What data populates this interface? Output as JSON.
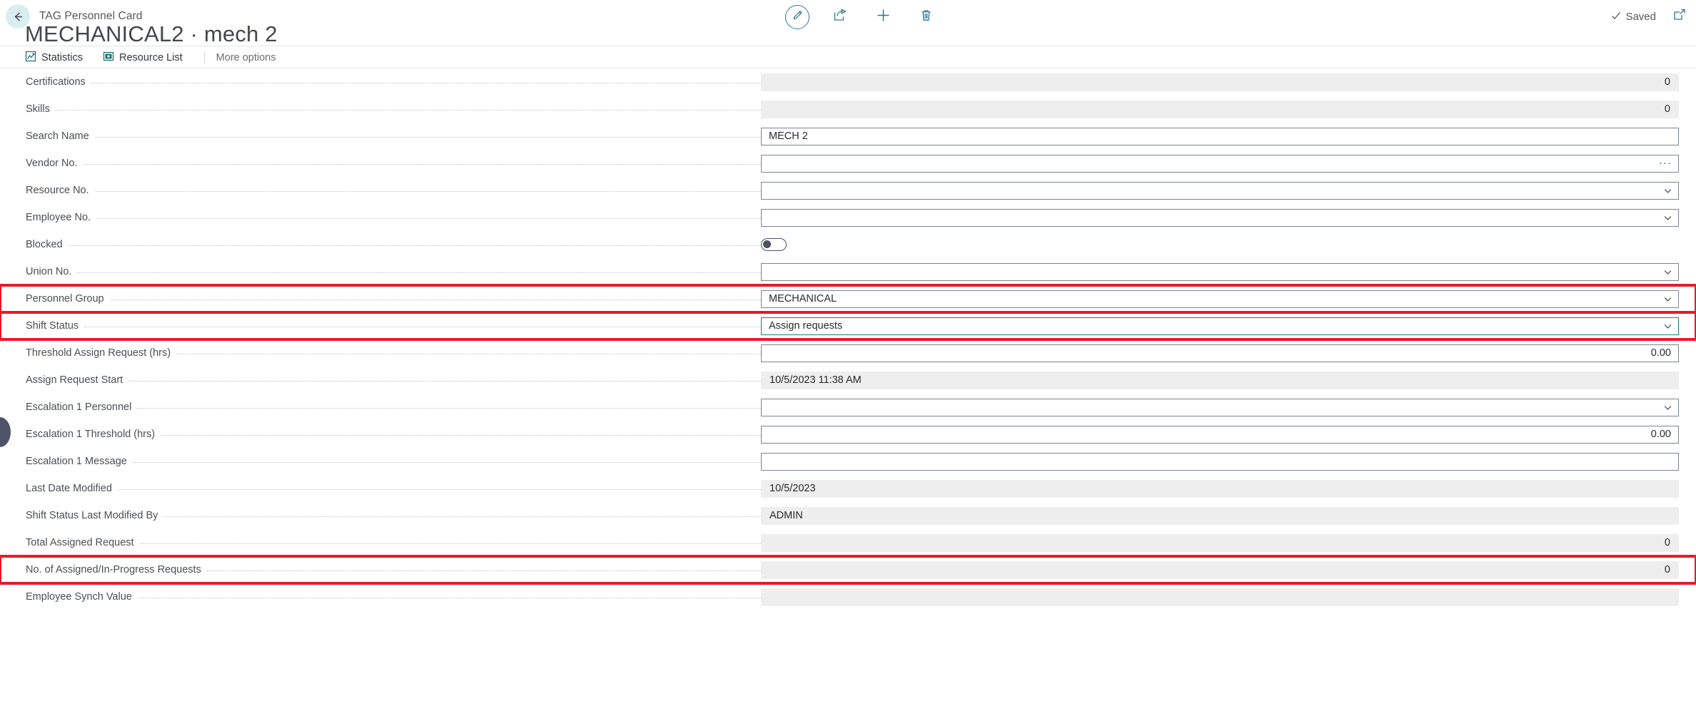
{
  "header": {
    "back_label": "back-arrow",
    "page_type": "TAG Personnel Card",
    "title": "MECHANICAL2 · mech 2",
    "saved_status": "Saved",
    "tools": [
      {
        "name": "edit-pencil-icon",
        "label": "Edit"
      },
      {
        "name": "share-icon",
        "label": "Share"
      },
      {
        "name": "new-plus-icon",
        "label": "New"
      },
      {
        "name": "delete-trash-icon",
        "label": "Delete"
      }
    ],
    "expand_label": "Open in new window"
  },
  "ribbon": {
    "items": [
      {
        "label": "Statistics",
        "icon": "statistics-chart-icon"
      },
      {
        "label": "Resource List",
        "icon": "resource-list-icon"
      }
    ],
    "more_options": "More options"
  },
  "fields": [
    {
      "label": "Certifications",
      "value": "0",
      "type": "readonly",
      "align": "right",
      "highlight": false
    },
    {
      "label": "Skills",
      "value": "0",
      "type": "readonly",
      "align": "right",
      "highlight": false
    },
    {
      "label": "Search Name",
      "value": "MECH 2",
      "type": "editable",
      "align": "left",
      "highlight": false
    },
    {
      "label": "Vendor No.",
      "value": "",
      "type": "editable",
      "align": "left",
      "highlight": false,
      "control": "assist-edit"
    },
    {
      "label": "Resource No.",
      "value": "",
      "type": "editable",
      "align": "left",
      "highlight": false,
      "control": "dropdown"
    },
    {
      "label": "Employee No.",
      "value": "",
      "type": "editable",
      "align": "left",
      "highlight": false,
      "control": "dropdown"
    },
    {
      "label": "Blocked",
      "value": "",
      "type": "toggle",
      "align": "left",
      "highlight": false,
      "toggle_on": false
    },
    {
      "label": "Union No.",
      "value": "",
      "type": "editable",
      "align": "left",
      "highlight": false,
      "control": "dropdown"
    },
    {
      "label": "Personnel Group",
      "value": "MECHANICAL",
      "type": "editable",
      "align": "left",
      "highlight": true,
      "control": "dropdown"
    },
    {
      "label": "Shift Status",
      "value": "Assign requests",
      "type": "editable",
      "align": "left",
      "highlight": true,
      "control": "dropdown",
      "focused": true
    },
    {
      "label": "Threshold Assign Request (hrs)",
      "value": "0.00",
      "type": "editable",
      "align": "right",
      "highlight": false
    },
    {
      "label": "Assign Request Start",
      "value": "10/5/2023 11:38 AM",
      "type": "readonly",
      "align": "left",
      "highlight": false
    },
    {
      "label": "Escalation 1 Personnel",
      "value": "",
      "type": "editable",
      "align": "left",
      "highlight": false,
      "control": "dropdown"
    },
    {
      "label": "Escalation 1 Threshold (hrs)",
      "value": "0.00",
      "type": "editable",
      "align": "right",
      "highlight": false
    },
    {
      "label": "Escalation 1 Message",
      "value": "",
      "type": "editable",
      "align": "left",
      "highlight": false
    },
    {
      "label": "Last Date Modified",
      "value": "10/5/2023",
      "type": "readonly",
      "align": "left",
      "highlight": false
    },
    {
      "label": "Shift Status Last Modified By",
      "value": "ADMIN",
      "type": "readonly",
      "align": "left",
      "highlight": false
    },
    {
      "label": "Total Assigned Request",
      "value": "0",
      "type": "readonly",
      "align": "right",
      "highlight": false
    },
    {
      "label": "No. of Assigned/In-Progress Requests",
      "value": "0",
      "type": "readonly",
      "align": "right",
      "highlight": true
    },
    {
      "label": "Employee Synch Value",
      "value": "",
      "type": "readonly",
      "align": "left",
      "highlight": false
    }
  ],
  "colors": {
    "accent": "#2a7a94",
    "highlight": "#e8192c",
    "focus_border": "#128373",
    "readonly_bg": "#eeeeee"
  },
  "side_handle": {
    "name": "collapsed-panel-handle"
  }
}
